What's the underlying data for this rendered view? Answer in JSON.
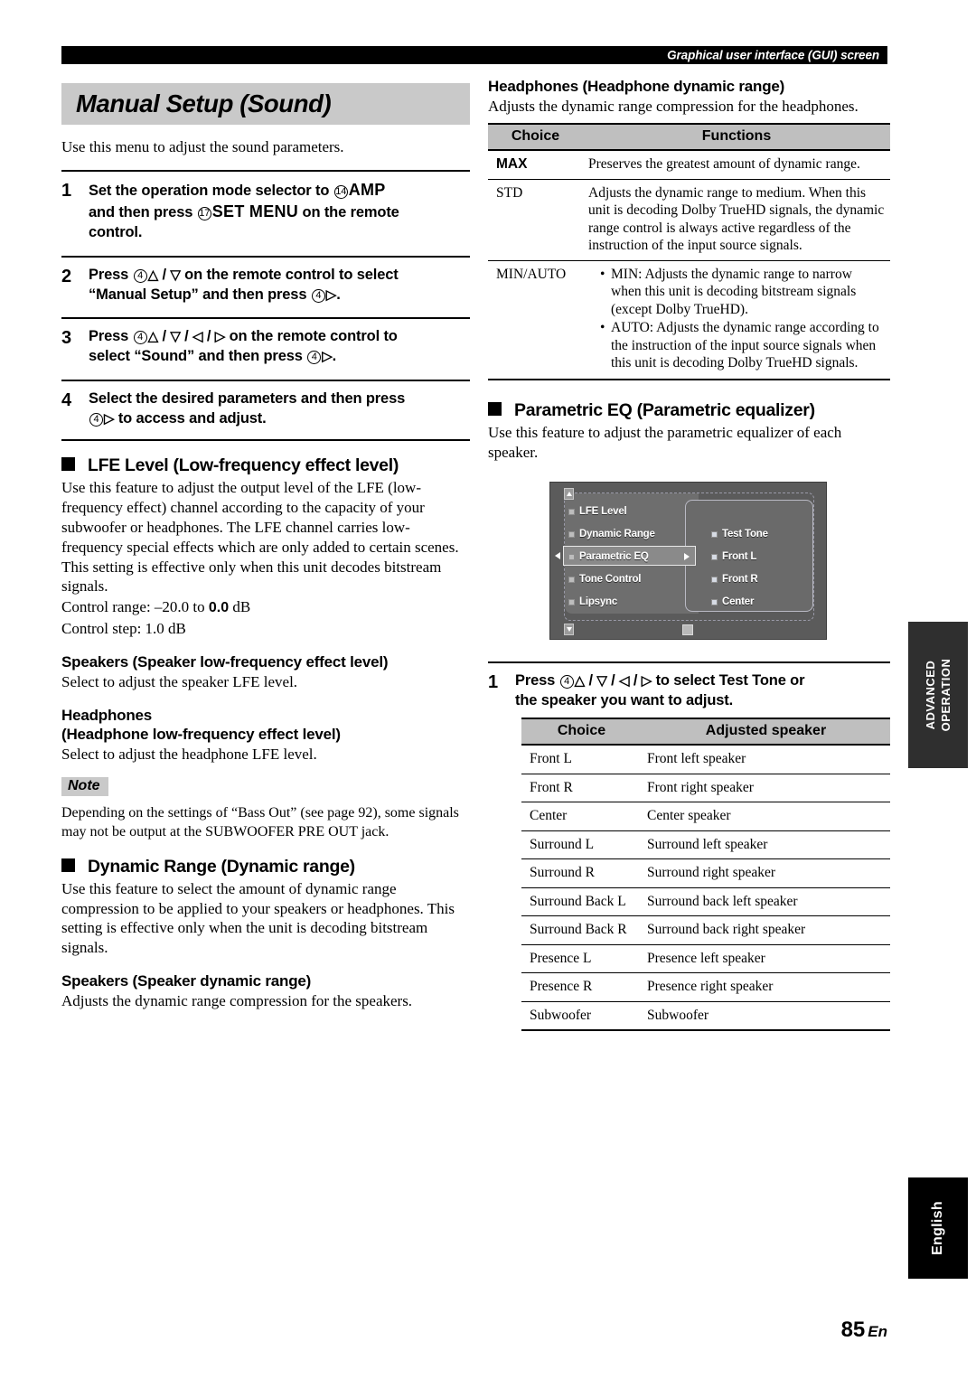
{
  "running_header": "Graphical user interface (GUI) screen",
  "page_footer": {
    "number": "85",
    "lang": "En"
  },
  "side_tabs": {
    "advanced_line1": "ADVANCED",
    "advanced_line2": "OPERATION",
    "language": "English"
  },
  "left": {
    "title": "Manual Setup (Sound)",
    "intro": "Use this menu to adjust the sound parameters.",
    "steps": [
      {
        "num": "1",
        "html_text": "Set the operation mode selector to ⑭ AMP and then press ⑰ SET MENU on the remote control."
      },
      {
        "num": "2",
        "html_text": "Press ④ △ / ▽ on the remote control to select “Manual Setup” and then press ④ ▷."
      },
      {
        "num": "3",
        "html_text": "Press ④ △ / ▽ / ◁ / ▷ on the remote control to select “Sound” and then press ④ ▷."
      },
      {
        "num": "4",
        "html_text": "Select the desired parameters and then press ④ ▷ to access and adjust."
      }
    ],
    "lfe": {
      "heading": "LFE Level (Low-frequency effect level)",
      "body": "Use this feature to adjust the output level of the LFE (low-frequency effect) channel according to the capacity of your subwoofer or headphones. The LFE channel carries low-frequency special effects which are only added to certain scenes. This setting is effective only when this unit decodes bitstream signals.",
      "control_range_label": "Control range: –20.0 to ",
      "control_range_value": "0.0",
      "control_range_unit": " dB",
      "control_step": "Control step: 1.0 dB",
      "speakers_heading": "Speakers (Speaker low-frequency effect level)",
      "speakers_body": "Select to adjust the speaker LFE level.",
      "headphones_heading_l1": "Headphones",
      "headphones_heading_l2": "(Headphone low-frequency effect level)",
      "headphones_body": "Select to adjust the headphone LFE level."
    },
    "note": {
      "tag": "Note",
      "body": "Depending on the settings of “Bass Out” (see page 92), some signals may not be output at the SUBWOOFER PRE OUT jack."
    },
    "dynamic_range": {
      "heading": "Dynamic Range (Dynamic range)",
      "body": "Use this feature to select the amount of dynamic range compression to be applied to your speakers or headphones. This setting is effective only when the unit is decoding bitstream signals.",
      "speakers_heading": "Speakers (Speaker dynamic range)",
      "speakers_body": "Adjusts the dynamic range compression for the speakers."
    }
  },
  "right": {
    "headphones": {
      "heading": "Headphones (Headphone dynamic range)",
      "body": "Adjusts the dynamic range compression for the headphones.",
      "table": {
        "headers": [
          "Choice",
          "Functions"
        ],
        "rows": [
          {
            "choice": "MAX",
            "bold_choice": true,
            "function": "Preserves the greatest amount of dynamic range.",
            "bullets": []
          },
          {
            "choice": "STD",
            "bold_choice": false,
            "function": "Adjusts the dynamic range to medium. When this unit is decoding Dolby TrueHD signals, the dynamic range control is always active regardless of the instruction of the input source signals.",
            "bullets": []
          },
          {
            "choice": "MIN/AUTO",
            "bold_choice": false,
            "function": "",
            "bullets": [
              "MIN: Adjusts the dynamic range to narrow when this unit is decoding bitstream signals (except Dolby TrueHD).",
              "AUTO: Adjusts the dynamic range according to the instruction of the input source signals when this unit is decoding Dolby TrueHD signals."
            ]
          }
        ]
      }
    },
    "parametric_eq": {
      "heading": "Parametric EQ (Parametric equalizer)",
      "body": "Use this feature to adjust the parametric equalizer of each speaker.",
      "gui_screen": {
        "left_menu": [
          "LFE Level",
          "Dynamic Range",
          "Parametric EQ",
          "Tone Control",
          "Lipsync"
        ],
        "highlighted": "Parametric EQ",
        "right_menu": [
          "Test Tone",
          "Front L",
          "Front R",
          "Center"
        ]
      },
      "step": {
        "num": "1",
        "html_text": "Press ④ △ / ▽ / ◁ / ▷ to select Test Tone or the speaker you want to adjust."
      },
      "table": {
        "headers": [
          "Choice",
          "Adjusted speaker"
        ],
        "rows": [
          [
            "Front L",
            "Front left speaker"
          ],
          [
            "Front R",
            "Front right speaker"
          ],
          [
            "Center",
            "Center speaker"
          ],
          [
            "Surround L",
            "Surround left speaker"
          ],
          [
            "Surround R",
            "Surround right speaker"
          ],
          [
            "Surround Back L",
            "Surround back left speaker"
          ],
          [
            "Surround Back R",
            "Surround back right speaker"
          ],
          [
            "Presence L",
            "Presence left speaker"
          ],
          [
            "Presence R",
            "Presence right speaker"
          ],
          [
            "Subwoofer",
            "Subwoofer"
          ]
        ]
      }
    }
  }
}
